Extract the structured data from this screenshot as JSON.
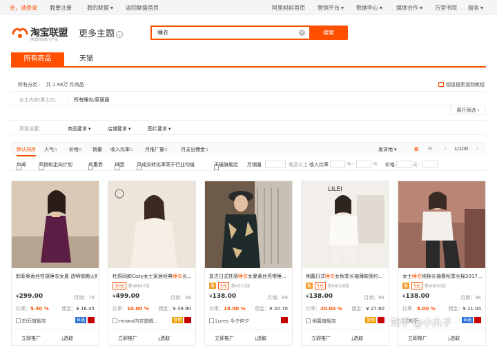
{
  "topbar": {
    "login": "亲，请登录",
    "register": "我要注册",
    "my_alliance": "我的联盟",
    "home": "返回联盟首页",
    "alimama_home": "阿里妈妈首页",
    "marketing": "营销平台",
    "data_center": "数据中心",
    "media": "媒体合作",
    "academy": "万堂书院",
    "service": "服务"
  },
  "logo": {
    "title": "淘宝联盟",
    "slogan": "阿里妈妈旗下产品"
  },
  "more_topics": "更多主题",
  "search": {
    "value": "睡衣",
    "button": "搜索"
  },
  "tabs": {
    "all": "所有商品",
    "tmall": "天猫"
  },
  "crumb": {
    "category": "所有分类",
    "count": "共 1.98万 件商品"
  },
  "adv_search": "超级搜索视频教程",
  "categories": {
    "c1": "女士内衣/男士内...",
    "c2": "所有睡衣/家居服"
  },
  "expand": "展开筛选",
  "filters": {
    "label": "高级设置：",
    "item": "商品要求",
    "shop": "店铺要求",
    "image": "图片要求"
  },
  "sort": {
    "default": "默认排序",
    "popularity": "人气",
    "price": "价格",
    "sales": "销量",
    "ratio": "收入比率",
    "monthly_promo": "月推广量",
    "monthly_comm": "月支出佣金",
    "shipping": "发货地",
    "page": "1/100"
  },
  "checks": {
    "shipping_free": "包邮",
    "marketing_plan": "营销和定向计划",
    "coupon": "优惠券",
    "group": "拼团",
    "conversion": "月成交转化率高于行业均值",
    "tmall_flagship": "天猫旗舰店",
    "monthly_sales": "月销量",
    "above": "笔及以上",
    "income_ratio": "收入比率",
    "pct": "%",
    "dash": "-",
    "price": "价格",
    "yuan": "元",
    "dash2": "-"
  },
  "cards": [
    {
      "title_pre": "韵菲奥香丝性感睡衣女夏 透明情趣火辣吊带睡裙 成人情趣",
      "title_hl": "睡衣",
      "title_post": "短裙",
      "badge": "",
      "price": "299.00",
      "sales": "月销：78",
      "ratio": "5.50 %",
      "commission": "¥ 16.45",
      "shop": "韵菲旗舰店",
      "markers": [
        "自选",
        "天猫"
      ],
      "promote": "立即推广",
      "select": "选取"
    },
    {
      "title_pre": "杜蔚同款Cozy女士家居经典",
      "title_hl": "睡衣",
      "title_post": "长...",
      "badge_coupon": "30元",
      "badge": "券98847张",
      "price": "499.00",
      "sales": "月销：46",
      "ratio": "10.00 %",
      "commission": "¥ 49.90",
      "shop": "neiwai内衣旗舰...",
      "markers": [
        "营销",
        "天猫"
      ],
      "promote": "立即推广",
      "select": "选取"
    },
    {
      "title_pre": "复古日式性感",
      "title_hl": "睡衣",
      "title_post": "女夏黄丝亮带睡...",
      "badge_ju": "聚",
      "badge_coupon": "5元",
      "badge": "券4373张",
      "price": "138.00",
      "sales": "月销：89",
      "ratio": "15.00 %",
      "commission": "¥ 20.70",
      "shop": "Lures 今夕何夕",
      "markers": [
        "天猫"
      ],
      "promote": "立即推广",
      "select": "选取"
    },
    {
      "title_pre": "俐蕾日式",
      "title_hl": "睡衣",
      "title_post": "女秋季长袖薄款简约...",
      "badge_ju": "聚",
      "badge_coupon": "5元",
      "badge": "券98018张",
      "price": "138.00",
      "sales": "月销：96",
      "ratio": "20.00 %",
      "commission": "¥ 27.60",
      "shop": "俐蕾旗舰店",
      "markers": [
        "营销",
        "天猫"
      ],
      "promote": "立即推广",
      "select": "选取"
    },
    {
      "title_pre": "女士",
      "title_hl": "睡衣",
      "title_post": "纯棉长袖春秋季全棉2017...",
      "badge_ju": "聚",
      "badge_coupon": "5元",
      "badge": "券90000张",
      "price": "138.00",
      "sales": "月销：96",
      "ratio": "8.00 %",
      "commission": "¥ 11.04",
      "shop": "知乎",
      "markers": [
        "自选",
        "天猫"
      ],
      "promote": "立即推广",
      "select": "选取"
    }
  ],
  "labels": {
    "yen": "¥",
    "ratio": "比率：",
    "commission": "佣金："
  },
  "watermark": "知乎 @小丸子",
  "colors": {
    "accent": "#ff5000"
  }
}
